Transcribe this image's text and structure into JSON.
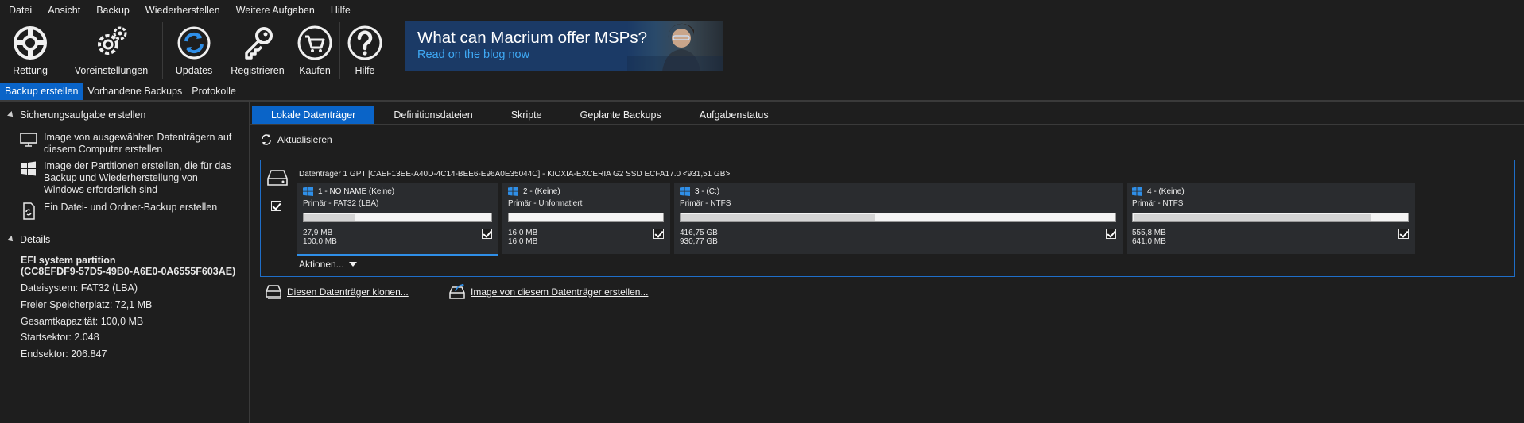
{
  "menu": [
    "Datei",
    "Ansicht",
    "Backup",
    "Wiederherstellen",
    "Weitere Aufgaben",
    "Hilfe"
  ],
  "toolbar": {
    "rettung": "Rettung",
    "voreinstellungen": "Voreinstellungen",
    "updates": "Updates",
    "registrieren": "Registrieren",
    "kaufen": "Kaufen",
    "hilfe": "Hilfe"
  },
  "banner": {
    "title": "What can Macrium offer MSPs?",
    "subtitle": "Read on the blog now"
  },
  "subtabs": [
    "Backup erstellen",
    "Vorhandene Backups",
    "Protokolle"
  ],
  "sidebar": {
    "section1": "Sicherungsaufgabe erstellen",
    "task1": "Image von ausgewählten Datenträgern auf diesem Computer erstellen",
    "task2": "Image der Partitionen erstellen, die für das Backup und Wiederherstellung von Windows erforderlich sind",
    "task3": "Ein Datei- und Ordner-Backup erstellen",
    "section2": "Details",
    "partition_name": "EFI system partition",
    "partition_guid": "(CC8EFDF9-57D5-49B0-A6E0-0A6555F603AE)",
    "filesystem": "Dateisystem: FAT32 (LBA)",
    "free": "Freier Speicherplatz: 72,1 MB",
    "capacity": "Gesamtkapazität: 100,0 MB",
    "start": "Startsektor: 2.048",
    "end": "Endsektor: 206.847"
  },
  "tabs": [
    "Lokale Datenträger",
    "Definitionsdateien",
    "Skripte",
    "Geplante Backups",
    "Aufgabenstatus"
  ],
  "refresh_label": "Aktualisieren",
  "disk": {
    "title": "Datenträger 1 GPT [CAEF13EE-A40D-4C14-BEE6-E96A0E35044C] - KIOXIA-EXCERIA G2 SSD ECFA17.0  <931,51 GB>",
    "actions_label": "Aktionen...",
    "partitions": [
      {
        "title": "1 - NO NAME (Keine)",
        "type": "Primär - FAT32 (LBA)",
        "used": "27,9 MB",
        "total": "100,0 MB",
        "fill_fraction": 0.28
      },
      {
        "title": "2 -  (Keine)",
        "type": "Primär - Unformatiert",
        "used": "16,0 MB",
        "total": "16,0 MB",
        "fill_fraction": 0.0
      },
      {
        "title": "3 -  (C:)",
        "type": "Primär - NTFS",
        "used": "416,75 GB",
        "total": "930,77 GB",
        "fill_fraction": 0.45
      },
      {
        "title": "4 -  (Keine)",
        "type": "Primär - NTFS",
        "used": "555,8 MB",
        "total": "641,0 MB",
        "fill_fraction": 0.87
      }
    ]
  },
  "link_clone": "Diesen Datenträger klonen...",
  "link_image": "Image von diesem Datenträger erstellen..."
}
